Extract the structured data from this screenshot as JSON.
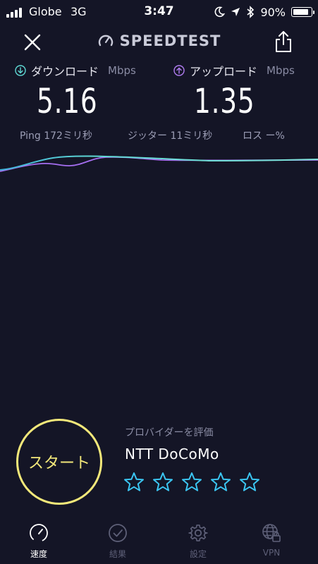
{
  "status_bar": {
    "carrier": "Globe",
    "network": "3G",
    "time": "3:47",
    "battery_percent": "90%",
    "battery_level": 0.9,
    "icons": [
      "signal-icon",
      "moon-icon",
      "location-arrow-icon",
      "bluetooth-icon",
      "battery-icon"
    ]
  },
  "header": {
    "logo": "SPEEDTEST",
    "close_icon": "close-icon",
    "share_icon": "share-icon"
  },
  "download": {
    "label": "ダウンロード",
    "unit": "Mbps",
    "value": "5.16",
    "color": "#5fd9d4"
  },
  "upload": {
    "label": "アップロード",
    "unit": "Mbps",
    "value": "1.35",
    "color": "#b07cf0"
  },
  "stats": {
    "ping": "Ping  172ミリ秒",
    "jitter": "ジッター  11ミリ秒",
    "loss": "ロス  ー%"
  },
  "start_button": {
    "label": "スタート",
    "color": "#f3e87a"
  },
  "rating": {
    "title": "プロバイダーを評価",
    "isp": "NTT DoCoMo",
    "stars_total": 5,
    "stars_filled": 0,
    "star_color": "#3bc6f2"
  },
  "tabs": [
    {
      "label": "速度",
      "icon": "speedometer-icon",
      "active": true
    },
    {
      "label": "結果",
      "icon": "checkmark-circle-icon",
      "active": false
    },
    {
      "label": "設定",
      "icon": "gear-icon",
      "active": false
    },
    {
      "label": "VPN",
      "icon": "vpn-lock-icon",
      "active": false
    }
  ]
}
